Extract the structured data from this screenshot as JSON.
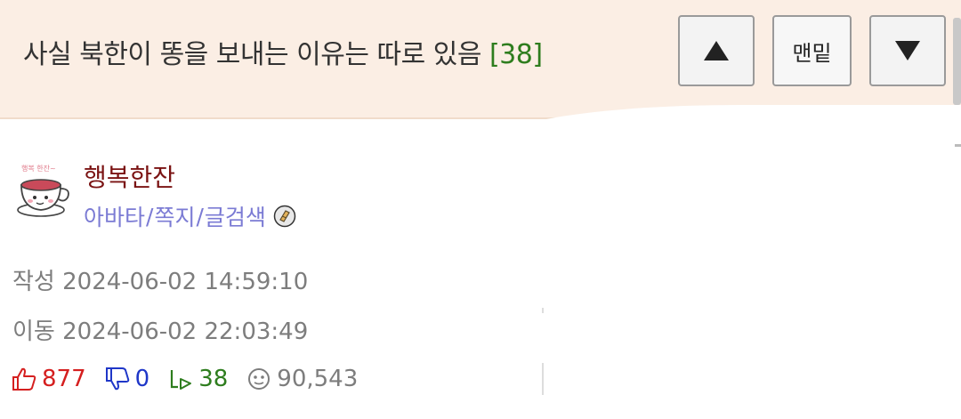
{
  "post": {
    "title": "사실 북한이 똥을 보내는 이유는 따로 있음",
    "comment_count": "[38]"
  },
  "nav": {
    "bottom_label": "맨밑",
    "up_icon": "triangle-up-icon",
    "down_icon": "triangle-down-icon"
  },
  "author": {
    "nickname": "행복한잔",
    "link_avatar": "아바타",
    "link_message": "쪽지",
    "link_search": "글검색",
    "separator": "/",
    "avatar_icon": "teacup-avatar-icon",
    "badge_icon": "level-badge-icon"
  },
  "meta": {
    "written_label": "작성",
    "written_time": "2024-06-02 14:59:10",
    "moved_label": "이동",
    "moved_time": "2024-06-02 22:03:49"
  },
  "stats": {
    "likes": "877",
    "dislikes": "0",
    "replies": "38",
    "views": "90,543"
  },
  "colors": {
    "header_bg": "#fbeee4",
    "comment_count": "#2e7d1e",
    "nickname": "#7a1212",
    "links": "#7b7bd4",
    "like": "#d51f1f",
    "dislike": "#1f37c8",
    "reply": "#2e7d1e",
    "meta_text": "#7d7d7d"
  }
}
